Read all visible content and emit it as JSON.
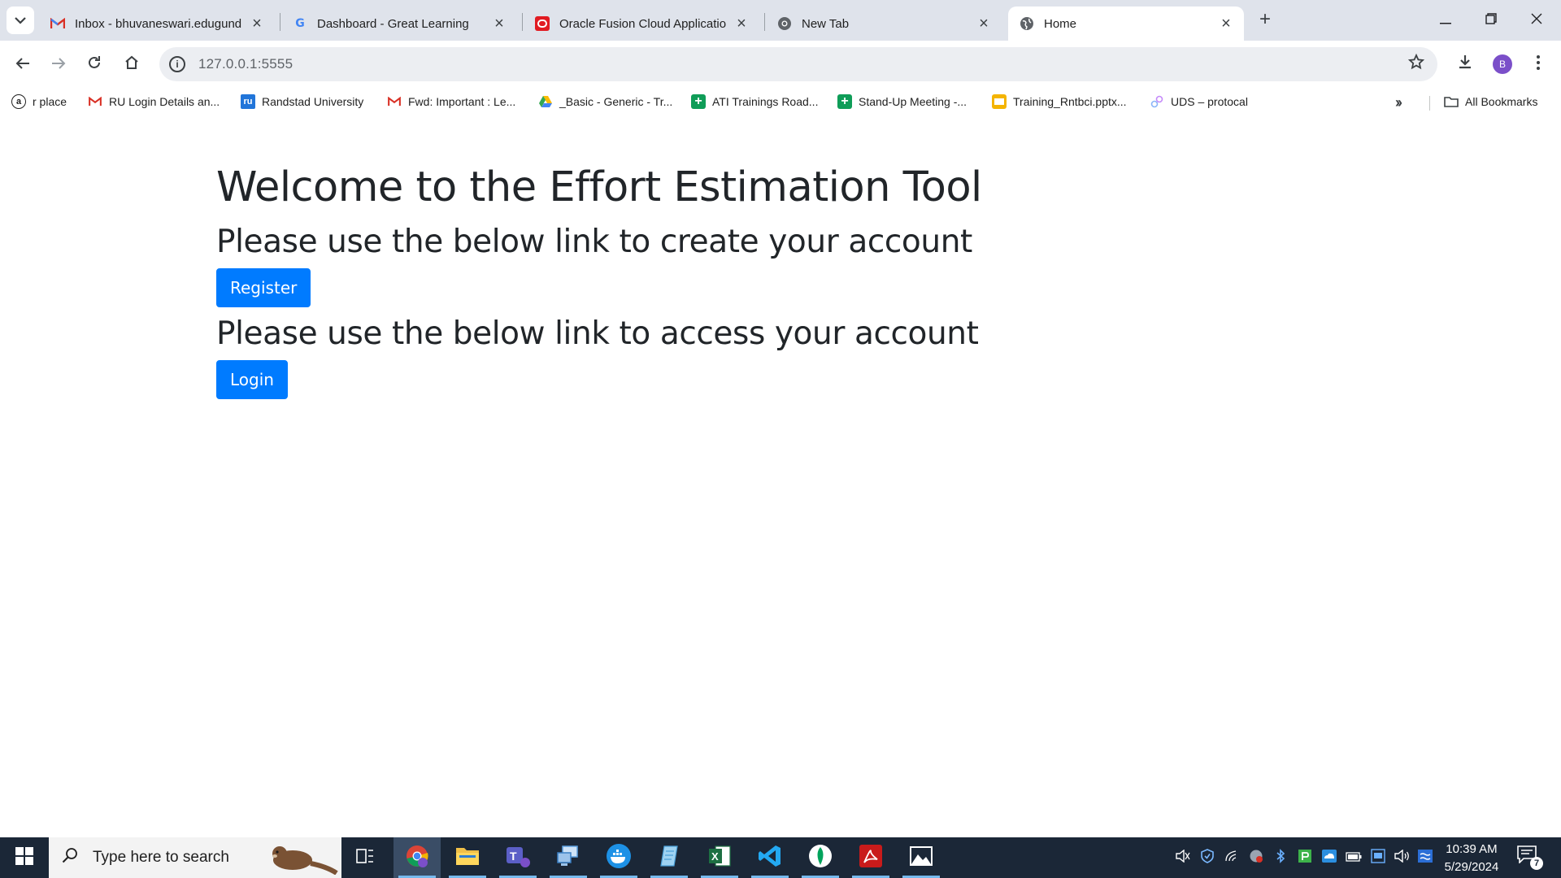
{
  "browser": {
    "tabs": [
      {
        "title": "Inbox - bhuvaneswari.edugundl",
        "icon": "gmail-icon",
        "active": false
      },
      {
        "title": "Dashboard - Great Learning",
        "icon": "google-icon",
        "active": false
      },
      {
        "title": "Oracle Fusion Cloud Applicatior",
        "icon": "oracle-icon",
        "active": false
      },
      {
        "title": "New Tab",
        "icon": "chrome-icon",
        "active": false
      },
      {
        "title": "Home",
        "icon": "globe-icon",
        "active": true
      }
    ],
    "url": "127.0.0.1:5555",
    "profile_initial": "B",
    "bookmarks": [
      {
        "label": "r place",
        "icon": "amazon-icon"
      },
      {
        "label": "RU Login Details an...",
        "icon": "gmail-icon"
      },
      {
        "label": "Randstad University",
        "icon": "randstad-icon"
      },
      {
        "label": "Fwd: Important : Le...",
        "icon": "gmail-icon"
      },
      {
        "label": "_Basic - Generic - Tr...",
        "icon": "google-drive-icon"
      },
      {
        "label": "ATI Trainings Road...",
        "icon": "google-sheets-icon"
      },
      {
        "label": "Stand-Up Meeting -...",
        "icon": "google-sheets-icon"
      },
      {
        "label": "Training_Rntbci.pptx...",
        "icon": "google-slides-icon"
      },
      {
        "label": "UDS – protocal",
        "icon": "link-icon"
      }
    ],
    "all_bookmarks_label": "All Bookmarks"
  },
  "page": {
    "title": "Welcome to the Effort Estimation Tool",
    "register_prompt": "Please use the below link to create your account",
    "register_button": "Register",
    "login_prompt": "Please use the below link to access your account",
    "login_button": "Login"
  },
  "taskbar": {
    "search_placeholder": "Type here to search",
    "time": "10:39 AM",
    "date": "5/29/2024",
    "notification_count": "7"
  },
  "colors": {
    "primary_button": "#007bff",
    "taskbar": "#1b2737",
    "tabstrip": "#dfe3eb"
  }
}
